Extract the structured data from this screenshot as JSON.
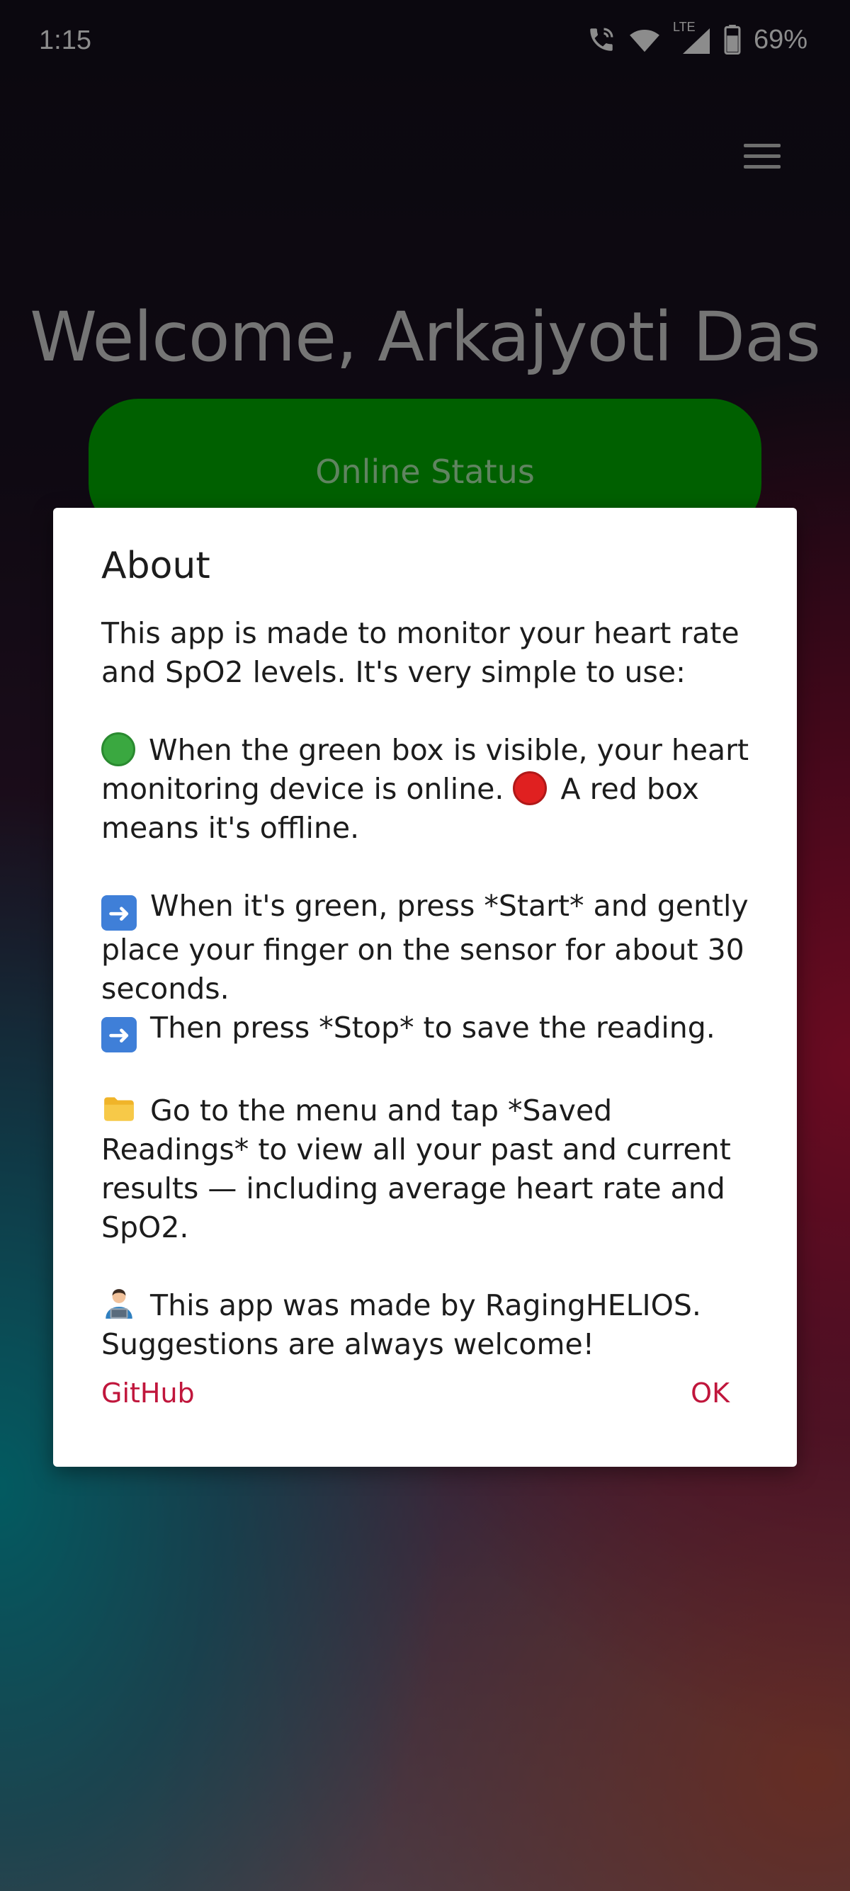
{
  "status_bar": {
    "time": "1:15",
    "battery": "69%",
    "network": "LTE"
  },
  "header": {
    "welcome": "Welcome, Arkajyoti Das"
  },
  "online_status": {
    "label": "Online Status",
    "color": "#00b000"
  },
  "dialog": {
    "title": "About",
    "paragraphs": [
      "This app is made to monitor your heart rate and SpO2 levels. It's very simple to use:",
      " When the green box is visible, your heart monitoring device is online.",
      " A red box means it's offline.",
      " When it's green, press *Start* and gently place your finger on the sensor for about 30 seconds.",
      " Then press *Stop* to save the reading.",
      " Go to the menu and tap *Saved Readings* to view all your past and current results — including average heart rate and SpO2.",
      " This app was made by RagingHELIOS. Suggestions are always welcome!"
    ],
    "buttons": {
      "github": "GitHub",
      "ok": "OK"
    },
    "accent_color": "#c0163c"
  },
  "icons": {
    "status": [
      "phone-call-icon",
      "wifi-icon",
      "signal-icon",
      "battery-icon"
    ],
    "menu": "hamburger-menu-icon",
    "emoji": [
      "green-circle-icon",
      "red-circle-icon",
      "right-arrow-icon",
      "folder-icon",
      "technologist-icon"
    ]
  }
}
